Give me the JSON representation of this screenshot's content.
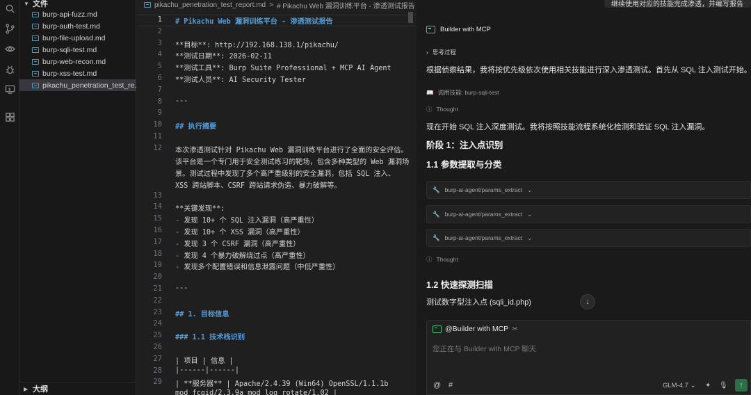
{
  "explorer": {
    "header": "文件",
    "files": [
      "burp-api-fuzz.md",
      "burp-auth-test.md",
      "burp-file-upload.md",
      "burp-sqli-test.md",
      "burp-web-recon.md",
      "burp-xss-test.md",
      "pikachu_penetration_test_re..."
    ],
    "outline_label": "大纲"
  },
  "breadcrumb": {
    "file": "pikachu_penetration_test_report.md",
    "separator": ">",
    "section": "# Pikachu Web 漏洞训练平台 - 渗透测试报告"
  },
  "editor": {
    "lines": [
      {
        "n": "1",
        "text": "# Pikachu Web 漏洞训练平台 - 渗透测试报告",
        "kind": "heading"
      },
      {
        "n": "2",
        "text": "",
        "kind": "text"
      },
      {
        "n": "3",
        "text": "**目标**: http://192.168.138.1/pikachu/",
        "kind": "text"
      },
      {
        "n": "4",
        "text": "**测试日期**: 2026-02-11",
        "kind": "text"
      },
      {
        "n": "5",
        "text": "**测试工具**: Burp Suite Professional + MCP AI Agent",
        "kind": "text"
      },
      {
        "n": "6",
        "text": "**测试人员**: AI Security Tester",
        "kind": "text"
      },
      {
        "n": "7",
        "text": "",
        "kind": "text"
      },
      {
        "n": "8",
        "text": "---",
        "kind": "text"
      },
      {
        "n": "9",
        "text": "",
        "kind": "text"
      },
      {
        "n": "10",
        "text": "## 执行摘要",
        "kind": "heading"
      },
      {
        "n": "11",
        "text": "",
        "kind": "text"
      },
      {
        "n": "12",
        "text": "本次渗透测试针对 Pikachu Web 漏洞训练平台进行了全面的安全评估。",
        "kind": "text"
      },
      {
        "n": "",
        "text": "该平台是一个专门用于安全测试练习的靶场，包含多种类型的 Web 漏洞场",
        "kind": "text"
      },
      {
        "n": "",
        "text": "景。测试过程中发现了多个高严重级别的安全漏洞，包括 SQL 注入、",
        "kind": "text"
      },
      {
        "n": "",
        "text": "XSS 跨站脚本、CSRF 跨站请求伪造、暴力破解等。",
        "kind": "text"
      },
      {
        "n": "13",
        "text": "",
        "kind": "text"
      },
      {
        "n": "14",
        "text": "**关键发现**:",
        "kind": "text"
      },
      {
        "n": "15",
        "text": "- 发现 10+ 个 SQL 注入漏洞（高严重性）",
        "kind": "list"
      },
      {
        "n": "16",
        "text": "- 发现 10+ 个 XSS 漏洞（高严重性）",
        "kind": "list"
      },
      {
        "n": "17",
        "text": "- 发现 3 个 CSRF 漏洞（高严重性）",
        "kind": "list"
      },
      {
        "n": "18",
        "text": "- 发现 4 个暴力破解绕过点（高严重性）",
        "kind": "list"
      },
      {
        "n": "19",
        "text": "- 发现多个配置错误和信息泄露问题（中低严重性）",
        "kind": "list"
      },
      {
        "n": "20",
        "text": "",
        "kind": "text"
      },
      {
        "n": "21",
        "text": "---",
        "kind": "text"
      },
      {
        "n": "22",
        "text": "",
        "kind": "text"
      },
      {
        "n": "23",
        "text": "## 1. 目标信息",
        "kind": "heading"
      },
      {
        "n": "24",
        "text": "",
        "kind": "text"
      },
      {
        "n": "25",
        "text": "### 1.1 技术栈识别",
        "kind": "heading"
      },
      {
        "n": "26",
        "text": "",
        "kind": "text"
      },
      {
        "n": "27",
        "text": "| 项目 | 信息 |",
        "kind": "text"
      },
      {
        "n": "28",
        "text": "|------|------|",
        "kind": "text"
      },
      {
        "n": "29",
        "text": "| **服务器** | Apache/2.4.39 (Win64) OpenSSL/1.1.1b",
        "kind": "text"
      },
      {
        "n": "",
        "text": "mod_fcgid/2.3.9a mod_log_rotate/1.02 |",
        "kind": "text"
      }
    ]
  },
  "chat": {
    "top_message": "继续使用对应的技能完成渗透，并编写报告",
    "assistant_name": "Builder with MCP",
    "thinking_label": "思考过程",
    "intro": "根据侦察结果，我将按优先级依次使用相关技能进行深入渗透测试。首先从 SQL 注入测试开始。",
    "skill_call": "调用技能: burp-sqli-test",
    "thought_label": "Thought",
    "start_text": "现在开始 SQL 注入深度测试。我将按照技能流程系统化检测和验证 SQL 注入漏洞。",
    "phase1": "阶段 1：注入点识别",
    "section_1_1": "1.1 参数提取与分类",
    "tool_calls": [
      "burp-ai-agent/params_extract",
      "burp-ai-agent/params_extract",
      "burp-ai-agent/params_extract"
    ],
    "thought_label_2": "Thought",
    "section_1_2": "1.2 快速探测扫描",
    "probe_text": "测试数字型注入点 (sqli_id.php)",
    "composer": {
      "mention": "@Builder with MCP",
      "placeholder": "您正在与 Builder with MCP 聊天",
      "model": "GLM-4.7",
      "at_symbol": "@",
      "hash_symbol": "#"
    }
  },
  "colors": {
    "accent_green": "#4ec27a",
    "heading_blue": "#569cd6",
    "list_dash": "#ce9178"
  }
}
